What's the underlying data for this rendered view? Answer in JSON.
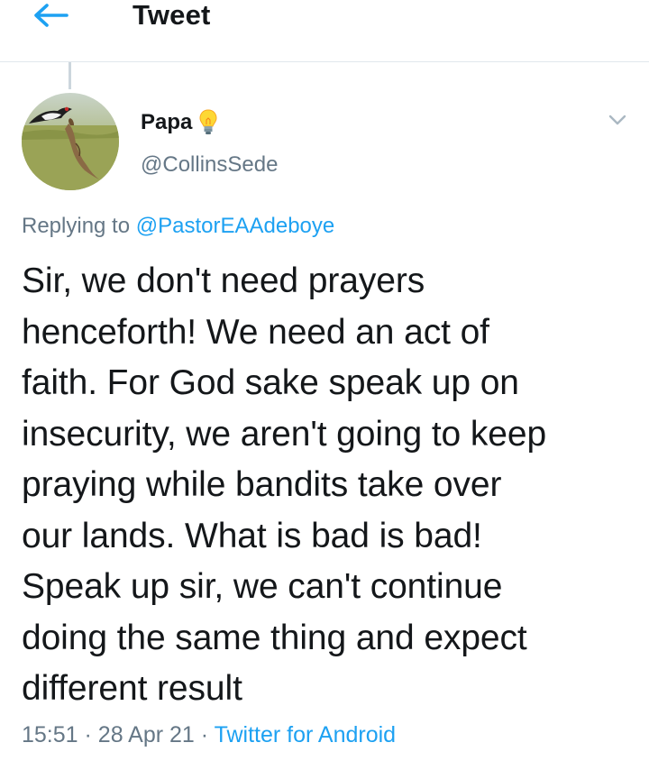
{
  "header": {
    "title": "Tweet",
    "back_icon": "back-arrow-icon",
    "accent_color": "#1da1f2"
  },
  "tweet": {
    "author": {
      "name": "Papa",
      "badge_icon": "lightbulb-icon",
      "handle": "@CollinsSede",
      "avatar_icon": "avatar-photo-bird-and-cat"
    },
    "reply_context": {
      "prefix": "Replying to",
      "mention": "@PastorEAAdeboye"
    },
    "text": "Sir, we don't need prayers\nhenceforth! We need an act of\nfaith. For God sake speak up on\ninsecurity, we aren't going to keep\npraying while bandits take over\nour lands. What is bad is bad!\nSpeak up sir, we can't continue\ndoing the same thing and expect\ndifferent result",
    "time": "15:51",
    "separator": "·",
    "date": "28 Apr 21",
    "source": "Twitter for Android",
    "menu_icon": "chevron-down-icon"
  },
  "colors": {
    "text_primary": "#14171a",
    "text_secondary": "#657786",
    "link": "#1da1f2",
    "divider": "#e1e8ed"
  }
}
